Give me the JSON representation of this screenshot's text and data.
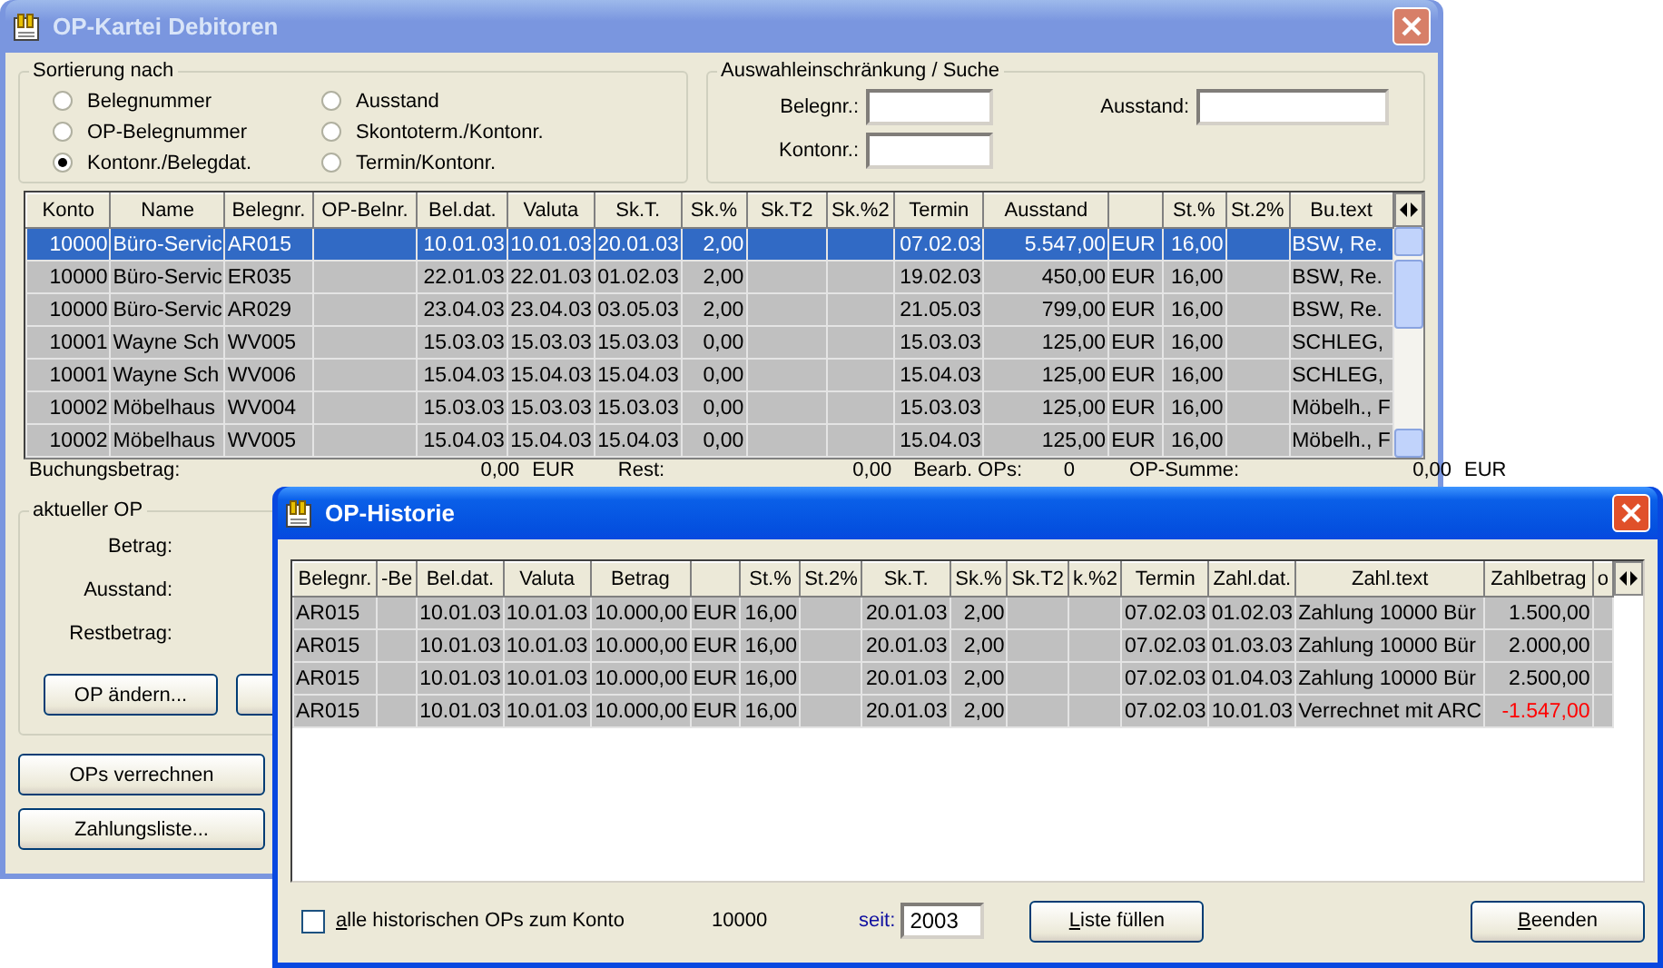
{
  "main_window": {
    "title": "OP-Kartei Debitoren",
    "active": false,
    "sort_group": {
      "title": "Sortierung nach",
      "options": [
        {
          "label": "Belegnummer",
          "selected": false
        },
        {
          "label": "OP-Belegnummer",
          "selected": false
        },
        {
          "label": "Kontonr./Belegdat.",
          "selected": true
        },
        {
          "label": "Ausstand",
          "selected": false
        },
        {
          "label": "Skontoterm./Kontonr.",
          "selected": false
        },
        {
          "label": "Termin/Kontonr.",
          "selected": false
        }
      ]
    },
    "search_group": {
      "title": "Auswahleinschränkung / Suche",
      "fields": [
        {
          "label": "Belegnr.:"
        },
        {
          "label": "Ausstand:"
        },
        {
          "label": "Kontonr.:"
        }
      ]
    },
    "table": {
      "columns": [
        {
          "label": "Konto"
        },
        {
          "label": "Name"
        },
        {
          "label": "Belegnr."
        },
        {
          "label": "OP-Belnr."
        },
        {
          "label": "Bel.dat."
        },
        {
          "label": "Valuta"
        },
        {
          "label": "Sk.T."
        },
        {
          "label": "Sk.%"
        },
        {
          "label": "Sk.T2"
        },
        {
          "label": "Sk.%2"
        },
        {
          "label": "Termin"
        },
        {
          "label": "Ausstand"
        },
        {},
        {
          "label": "St.%"
        },
        {
          "label": "St.2%"
        },
        {
          "label": "Bu.text"
        }
      ],
      "rows": [
        {
          "selected": true,
          "cells": [
            "10000",
            "Büro-Servic",
            "AR015",
            null,
            "10.01.03",
            "10.01.03",
            "20.01.03",
            "2,00",
            null,
            null,
            "07.02.03",
            "5.547,00",
            "EUR",
            "16,00",
            null,
            "BSW, Re."
          ]
        },
        {
          "selected": false,
          "cells": [
            "10000",
            "Büro-Servic",
            "ER035",
            null,
            "22.01.03",
            "22.01.03",
            "01.02.03",
            "2,00",
            null,
            null,
            "19.02.03",
            "450,00",
            "EUR",
            "16,00",
            null,
            "BSW, Re."
          ]
        },
        {
          "selected": false,
          "cells": [
            "10000",
            "Büro-Servic",
            "AR029",
            null,
            "23.04.03",
            "23.04.03",
            "03.05.03",
            "2,00",
            null,
            null,
            "21.05.03",
            "799,00",
            "EUR",
            "16,00",
            null,
            "BSW, Re."
          ]
        },
        {
          "selected": false,
          "cells": [
            "10001",
            "Wayne Sch",
            "WV005",
            null,
            "15.03.03",
            "15.03.03",
            "15.03.03",
            "0,00",
            null,
            null,
            "15.03.03",
            "125,00",
            "EUR",
            "16,00",
            null,
            "SCHLEG,"
          ]
        },
        {
          "selected": false,
          "cells": [
            "10001",
            "Wayne Sch",
            "WV006",
            null,
            "15.04.03",
            "15.04.03",
            "15.04.03",
            "0,00",
            null,
            null,
            "15.04.03",
            "125,00",
            "EUR",
            "16,00",
            null,
            "SCHLEG,"
          ]
        },
        {
          "selected": false,
          "cells": [
            "10002",
            "Möbelhaus",
            "WV004",
            null,
            "15.03.03",
            "15.03.03",
            "15.03.03",
            "0,00",
            null,
            null,
            "15.03.03",
            "125,00",
            "EUR",
            "16,00",
            null,
            "Möbelh., F"
          ]
        },
        {
          "selected": false,
          "cells": [
            "10002",
            "Möbelhaus",
            "WV005",
            null,
            "15.04.03",
            "15.04.03",
            "15.04.03",
            "0,00",
            null,
            null,
            "15.04.03",
            "125,00",
            "EUR",
            "16,00",
            null,
            "Möbelh., F"
          ]
        }
      ]
    },
    "summary": [
      {
        "label": "Buchungsbetrag:",
        "value": "0,00",
        "unit": "EUR"
      },
      {
        "label": "Rest:",
        "value": "0,00"
      },
      {
        "label": "Bearb. OPs:",
        "value": "0"
      },
      {
        "label": "OP-Summe:",
        "value": "0,00",
        "unit": "EUR"
      }
    ],
    "current_op": {
      "title": "aktueller OP",
      "labels": [
        "Betrag:",
        "Ausstand:",
        "Restbetrag:"
      ],
      "buttons": [
        "OP ändern..."
      ]
    },
    "buttons": [
      "OPs verrechnen",
      "Zahlungsliste..."
    ]
  },
  "history_window": {
    "title": "OP-Historie",
    "active": true,
    "table": {
      "columns": [
        {
          "label": "Belegnr."
        },
        {
          "label": "-Be"
        },
        {
          "label": "Bel.dat."
        },
        {
          "label": "Valuta"
        },
        {
          "label": "Betrag"
        },
        {},
        {
          "label": "St.%"
        },
        {
          "label": "St.2%"
        },
        {
          "label": "Sk.T."
        },
        {
          "label": "Sk.%"
        },
        {
          "label": "Sk.T2"
        },
        {
          "label": "k.%2"
        },
        {
          "label": "Termin"
        },
        {
          "label": "Zahl.dat."
        },
        {
          "label": "Zahl.text"
        },
        {
          "label": "Zahlbetrag"
        },
        {
          "label": "o"
        }
      ],
      "rows": [
        {
          "cells": [
            "AR015",
            null,
            "10.01.03",
            "10.01.03",
            "10.000,00",
            "EUR",
            "16,00",
            null,
            "20.01.03",
            "2,00",
            null,
            null,
            "07.02.03",
            "01.02.03",
            "Zahlung 10000 Bür"
          ],
          "amount": {
            "text": "1.500,00",
            "color": "#000000"
          }
        },
        {
          "cells": [
            "AR015",
            null,
            "10.01.03",
            "10.01.03",
            "10.000,00",
            "EUR",
            "16,00",
            null,
            "20.01.03",
            "2,00",
            null,
            null,
            "07.02.03",
            "01.03.03",
            "Zahlung 10000 Bür"
          ],
          "amount": {
            "text": "2.000,00",
            "color": "#000000"
          }
        },
        {
          "cells": [
            "AR015",
            null,
            "10.01.03",
            "10.01.03",
            "10.000,00",
            "EUR",
            "16,00",
            null,
            "20.01.03",
            "2,00",
            null,
            null,
            "07.02.03",
            "01.04.03",
            "Zahlung 10000 Bür"
          ],
          "amount": {
            "text": "2.500,00",
            "color": "#000000"
          }
        },
        {
          "cells": [
            "AR015",
            null,
            "10.01.03",
            "10.01.03",
            "10.000,00",
            "EUR",
            "16,00",
            null,
            "20.01.03",
            "2,00",
            null,
            null,
            "07.02.03",
            "10.01.03",
            "Verrechnet mit ARC"
          ],
          "amount": {
            "text": "-1.547,00",
            "color": "#ff0000"
          }
        }
      ]
    },
    "footer": {
      "checkbox": {
        "label": "alle historischen OPs zum Konto",
        "checked": false
      },
      "account": "10000",
      "since_label": "seit:",
      "since_value": "2003",
      "buttons": [
        "Liste füllen",
        "Beenden"
      ]
    }
  }
}
